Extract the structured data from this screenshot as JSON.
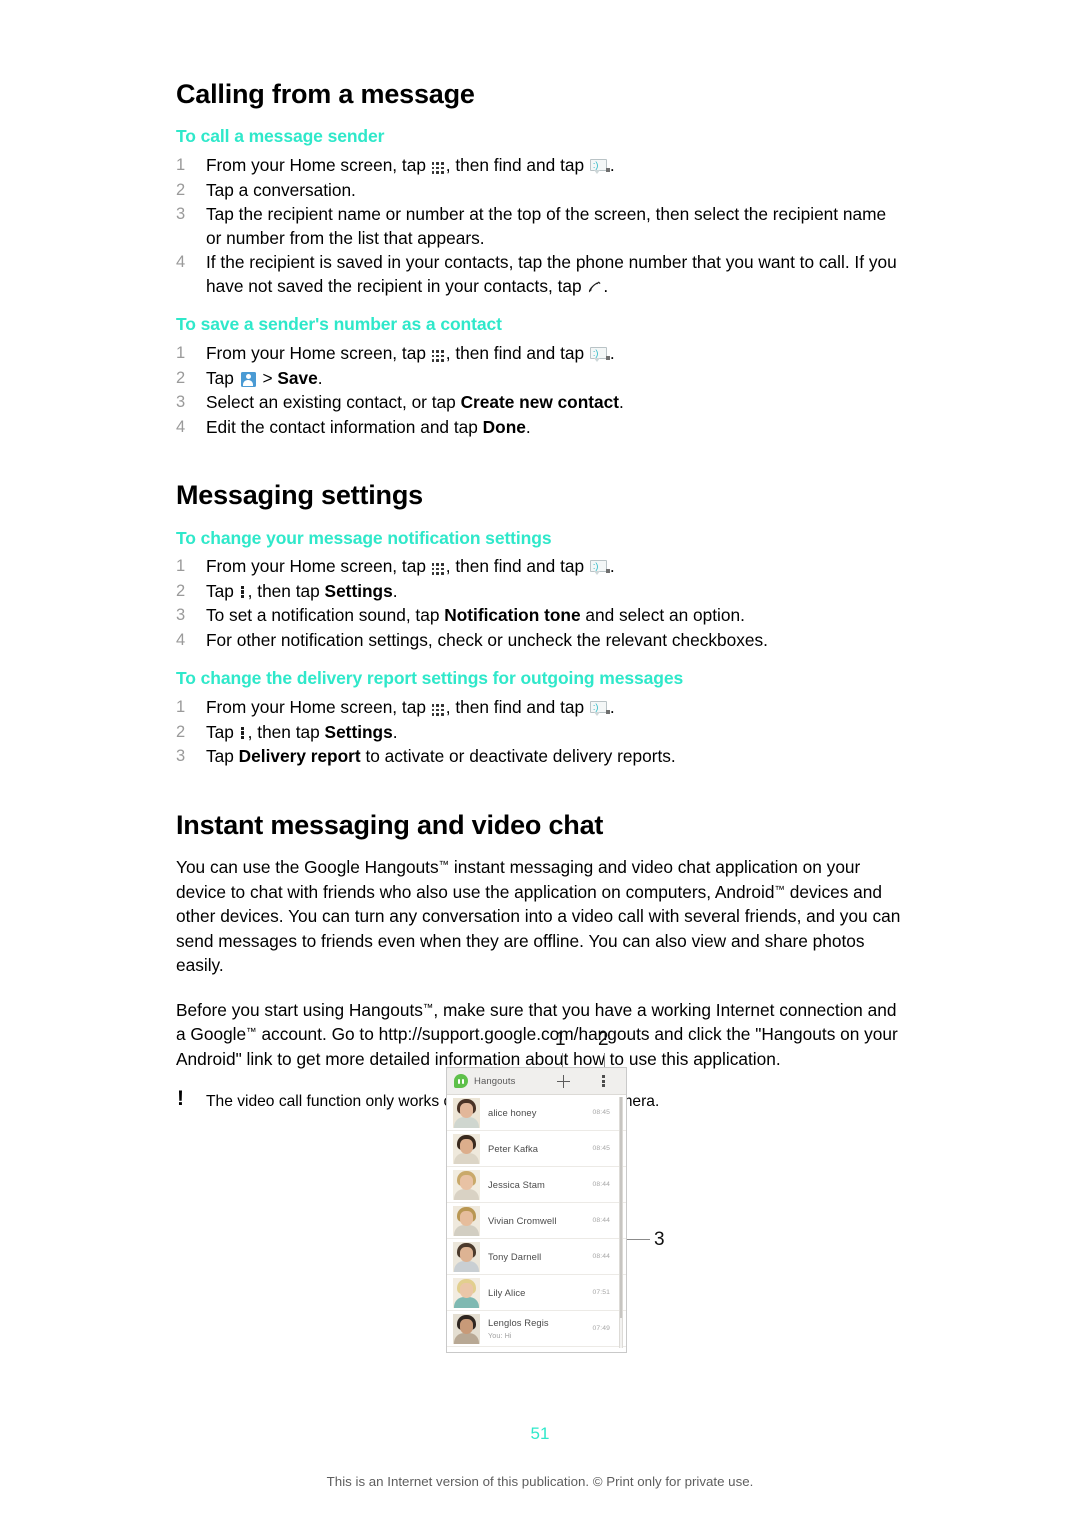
{
  "document": {
    "page_number": "51",
    "footer": "This is an Internet version of this publication. © Print only for private use."
  },
  "sections": [
    {
      "title": "Calling from a message",
      "subsections": [
        {
          "heading": "To call a message sender",
          "steps": [
            {
              "num": "1",
              "parts": [
                {
                  "t": "text",
                  "v": "From your Home screen, tap "
                },
                {
                  "t": "icon",
                  "v": "app-grid-icon"
                },
                {
                  "t": "text",
                  "v": ", then find and tap "
                },
                {
                  "t": "icon",
                  "v": "messaging-icon"
                },
                {
                  "t": "text",
                  "v": "."
                }
              ]
            },
            {
              "num": "2",
              "parts": [
                {
                  "t": "text",
                  "v": "Tap a conversation."
                }
              ]
            },
            {
              "num": "3",
              "parts": [
                {
                  "t": "text",
                  "v": "Tap the recipient name or number at the top of the screen, then select the recipient name or number from the list that appears."
                }
              ]
            },
            {
              "num": "4",
              "parts": [
                {
                  "t": "text",
                  "v": "If the recipient is saved in your contacts, tap the phone number that you want to call. If you have not saved the recipient in your contacts, tap "
                },
                {
                  "t": "icon",
                  "v": "phone-handset-icon"
                },
                {
                  "t": "text",
                  "v": "."
                }
              ]
            }
          ]
        },
        {
          "heading": "To save a sender's number as a contact",
          "steps": [
            {
              "num": "1",
              "parts": [
                {
                  "t": "text",
                  "v": "From your Home screen, tap "
                },
                {
                  "t": "icon",
                  "v": "app-grid-icon"
                },
                {
                  "t": "text",
                  "v": ", then find and tap "
                },
                {
                  "t": "icon",
                  "v": "messaging-icon"
                },
                {
                  "t": "text",
                  "v": "."
                }
              ]
            },
            {
              "num": "2",
              "parts": [
                {
                  "t": "text",
                  "v": "Tap "
                },
                {
                  "t": "icon",
                  "v": "contact-badge-icon"
                },
                {
                  "t": "text",
                  "v": " > "
                },
                {
                  "t": "bold",
                  "v": "Save"
                },
                {
                  "t": "text",
                  "v": "."
                }
              ]
            },
            {
              "num": "3",
              "parts": [
                {
                  "t": "text",
                  "v": "Select an existing contact, or tap "
                },
                {
                  "t": "bold",
                  "v": "Create new contact"
                },
                {
                  "t": "text",
                  "v": "."
                }
              ]
            },
            {
              "num": "4",
              "parts": [
                {
                  "t": "text",
                  "v": "Edit the contact information and tap "
                },
                {
                  "t": "bold",
                  "v": "Done"
                },
                {
                  "t": "text",
                  "v": "."
                }
              ]
            }
          ]
        }
      ]
    },
    {
      "title": "Messaging settings",
      "subsections": [
        {
          "heading": "To change your message notification settings",
          "steps": [
            {
              "num": "1",
              "parts": [
                {
                  "t": "text",
                  "v": "From your Home screen, tap "
                },
                {
                  "t": "icon",
                  "v": "app-grid-icon"
                },
                {
                  "t": "text",
                  "v": ", then find and tap "
                },
                {
                  "t": "icon",
                  "v": "messaging-icon"
                },
                {
                  "t": "text",
                  "v": "."
                }
              ]
            },
            {
              "num": "2",
              "parts": [
                {
                  "t": "text",
                  "v": "Tap "
                },
                {
                  "t": "icon",
                  "v": "overflow-menu-icon"
                },
                {
                  "t": "text",
                  "v": ", then tap "
                },
                {
                  "t": "bold",
                  "v": "Settings"
                },
                {
                  "t": "text",
                  "v": "."
                }
              ]
            },
            {
              "num": "3",
              "parts": [
                {
                  "t": "text",
                  "v": "To set a notification sound, tap "
                },
                {
                  "t": "bold",
                  "v": "Notification tone"
                },
                {
                  "t": "text",
                  "v": " and select an option."
                }
              ]
            },
            {
              "num": "4",
              "parts": [
                {
                  "t": "text",
                  "v": "For other notification settings, check or uncheck the relevant checkboxes."
                }
              ]
            }
          ]
        },
        {
          "heading": "To change the delivery report settings for outgoing messages",
          "steps": [
            {
              "num": "1",
              "parts": [
                {
                  "t": "text",
                  "v": "From your Home screen, tap "
                },
                {
                  "t": "icon",
                  "v": "app-grid-icon"
                },
                {
                  "t": "text",
                  "v": ", then find and tap "
                },
                {
                  "t": "icon",
                  "v": "messaging-icon"
                },
                {
                  "t": "text",
                  "v": "."
                }
              ]
            },
            {
              "num": "2",
              "parts": [
                {
                  "t": "text",
                  "v": "Tap "
                },
                {
                  "t": "icon",
                  "v": "overflow-menu-icon"
                },
                {
                  "t": "text",
                  "v": ", then tap "
                },
                {
                  "t": "bold",
                  "v": "Settings"
                },
                {
                  "t": "text",
                  "v": "."
                }
              ]
            },
            {
              "num": "3",
              "parts": [
                {
                  "t": "text",
                  "v": "Tap "
                },
                {
                  "t": "bold",
                  "v": "Delivery report"
                },
                {
                  "t": "text",
                  "v": " to activate or deactivate delivery reports."
                }
              ]
            }
          ]
        }
      ]
    },
    {
      "title": "Instant messaging and video chat",
      "paragraphs": [
        [
          {
            "t": "text",
            "v": "You can use the Google Hangouts"
          },
          {
            "t": "tm",
            "v": "™"
          },
          {
            "t": "text",
            "v": " instant messaging and video chat application on your device to chat with friends who also use the application on computers, Android"
          },
          {
            "t": "tm",
            "v": "™"
          },
          {
            "t": "text",
            "v": " devices and other devices. You can turn any conversation into a video call with several friends, and you can send messages to friends even when they are offline. You can also view and share photos easily."
          }
        ],
        [
          {
            "t": "text",
            "v": "Before you start using Hangouts"
          },
          {
            "t": "tm",
            "v": "™"
          },
          {
            "t": "text",
            "v": ", make sure that you have a working Internet connection and a Google"
          },
          {
            "t": "tm",
            "v": "™"
          },
          {
            "t": "text",
            "v": " account. Go to http://support.google.com/hangouts and click the \"Hangouts on your Android\" link to get more detailed information about how to use this application."
          }
        ]
      ],
      "note": {
        "marker": "!",
        "text": "The video call function only works on devices with a front camera."
      }
    }
  ],
  "figure": {
    "callouts": [
      {
        "label": "1",
        "target": "add-conversation-button"
      },
      {
        "label": "2",
        "target": "overflow-menu-button"
      },
      {
        "label": "3",
        "target": "scrollbar"
      }
    ],
    "app": {
      "title": "Hangouts",
      "logo": "hangouts-logo-icon",
      "add_icon": "plus-icon",
      "overflow_icon": "overflow-menu-icon"
    },
    "conversations": [
      {
        "name": "alice honey",
        "time": "08:45",
        "preview": ""
      },
      {
        "name": "Peter Kafka",
        "time": "08:45",
        "preview": ""
      },
      {
        "name": "Jessica Stam",
        "time": "08:44",
        "preview": ""
      },
      {
        "name": "Vivian Cromwell",
        "time": "08:44",
        "preview": ""
      },
      {
        "name": "Tony Darnell",
        "time": "08:44",
        "preview": ""
      },
      {
        "name": "Lily Alice",
        "time": "07:51",
        "preview": ""
      },
      {
        "name": "Lenglos Regis",
        "time": "07:49",
        "preview": "You: Hi"
      }
    ]
  },
  "colors": {
    "accent_teal": "#2fe8ca",
    "hangouts_green": "#5ec04a",
    "contact_badge_blue": "#4b9bd4",
    "step_number_grey": "#9a9a9a"
  }
}
